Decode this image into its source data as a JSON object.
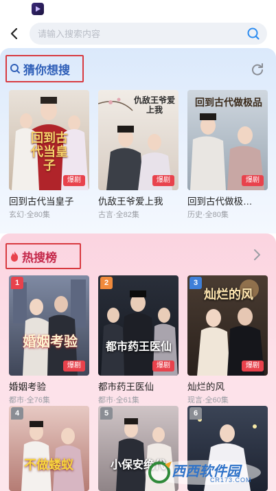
{
  "search": {
    "placeholder": "请输入搜索内容"
  },
  "guess": {
    "title": "猜你想搜",
    "items": [
      {
        "title": "回到古代当皇子",
        "genre": "玄幻",
        "episodes": "全80集",
        "badge": "爆剧",
        "cover_text": "回到古代当皇子"
      },
      {
        "title": "仇敌王爷爱上我",
        "genre": "古言",
        "episodes": "全82集",
        "badge": "爆剧",
        "cover_text": "仇敌王爷爱上我"
      },
      {
        "title": "回到古代做极…",
        "genre": "历史",
        "episodes": "全80集",
        "badge": "爆剧",
        "cover_text": "回到古代做极品"
      }
    ]
  },
  "hot": {
    "title": "热搜榜",
    "items": [
      {
        "rank": "1",
        "title": "婚姻考验",
        "genre": "都市",
        "episodes": "全76集",
        "badge": "爆剧",
        "cover_text": "婚姻考验"
      },
      {
        "rank": "2",
        "title": "都市药王医仙",
        "genre": "都市",
        "episodes": "全61集",
        "badge": "爆剧",
        "cover_text": "都市药王医仙"
      },
      {
        "rank": "3",
        "title": "灿烂的风",
        "genre": "现言",
        "episodes": "全60集",
        "badge": "爆剧",
        "cover_text": "灿烂的风"
      },
      {
        "rank": "4",
        "cover_text": "不做蝼蚁"
      },
      {
        "rank": "5",
        "cover_text": "小保安绝代"
      },
      {
        "rank": "6"
      }
    ]
  },
  "watermark": {
    "brand": "西西软件园",
    "url": "CR173.COM"
  },
  "colors": {
    "rank1": "#e8424c",
    "rank2": "#f08a3c",
    "rank3": "#3f7fd8",
    "rank_other": "#8a8d94",
    "badge": "#e8424c"
  }
}
